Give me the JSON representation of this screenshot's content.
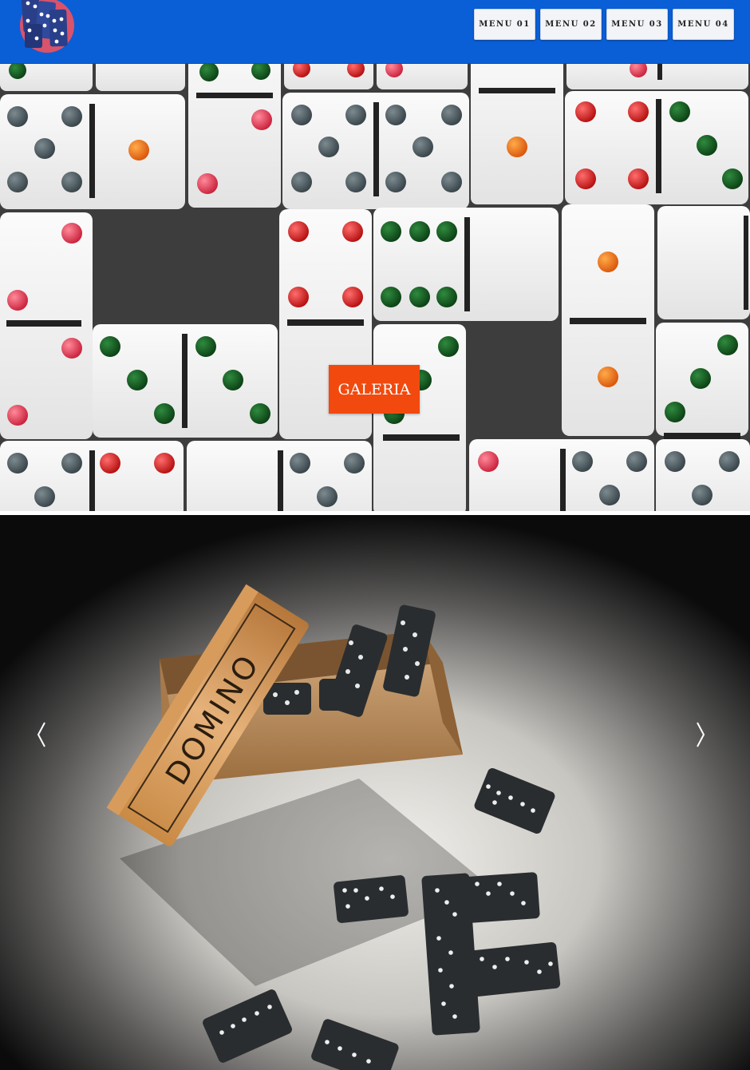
{
  "header": {
    "background_color": "#0b5fd6",
    "logo": {
      "icon": "dominoes-logo-icon"
    },
    "menu": [
      {
        "label": "MENU 01"
      },
      {
        "label": "MENU 02"
      },
      {
        "label": "MENU 03"
      },
      {
        "label": "MENU 04"
      }
    ]
  },
  "hero": {
    "image": "domino-tiles-photo",
    "button_label": "GALERIA",
    "button_color": "#f24a0e"
  },
  "slider": {
    "image": "domino-box-photo",
    "box_lid_text": "DOMINO",
    "prev_icon": "chevron-left-icon",
    "next_icon": "chevron-right-icon"
  }
}
